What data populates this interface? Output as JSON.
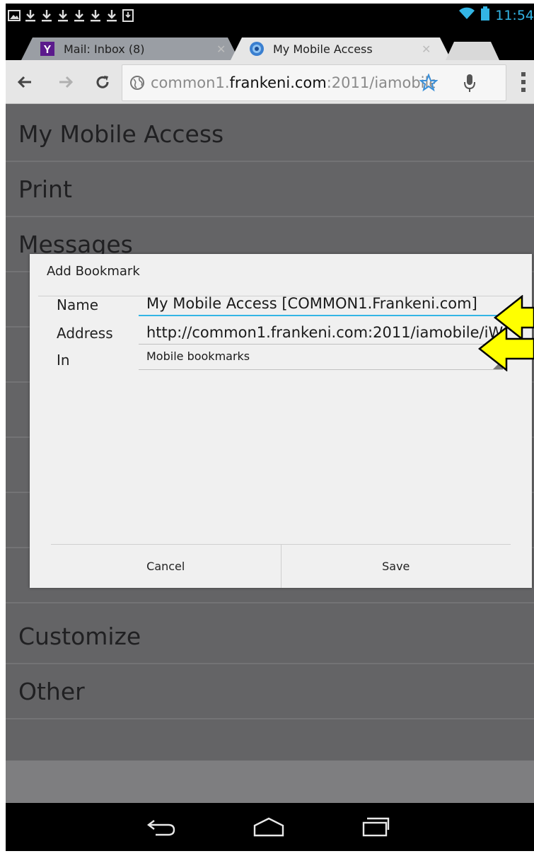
{
  "status_bar": {
    "time": "11:54",
    "notification_icons": [
      "gallery-icon",
      "download-icon",
      "download-icon",
      "download-icon",
      "download-icon",
      "download-icon",
      "download-icon",
      "download-box-icon"
    ]
  },
  "tabs": [
    {
      "title": "Mail: Inbox (8)",
      "active": false,
      "favicon": "yahoo-icon"
    },
    {
      "title": "My Mobile Access",
      "active": true,
      "favicon": "globe-icon"
    }
  ],
  "toolbar": {
    "url_prefix": "common1.",
    "url_host": "frankeni.com",
    "url_suffix": ":2011/iamobile"
  },
  "page": {
    "menu": [
      "My Mobile Access",
      "Print",
      "Messages",
      "Customize",
      "Other"
    ]
  },
  "dialog": {
    "title": "Add Bookmark",
    "name_label": "Name",
    "name_value": "My Mobile Access [COMMON1.Frankeni.com]",
    "address_label": "Address",
    "address_value": "http://common1.frankeni.com:2011/iamobile/iW",
    "in_label": "In",
    "in_value": "Mobile bookmarks",
    "cancel_label": "Cancel",
    "save_label": "Save"
  },
  "colors": {
    "accent": "#33b5e5",
    "arrow_fill": "#ffff00",
    "page_background": "#646466"
  }
}
